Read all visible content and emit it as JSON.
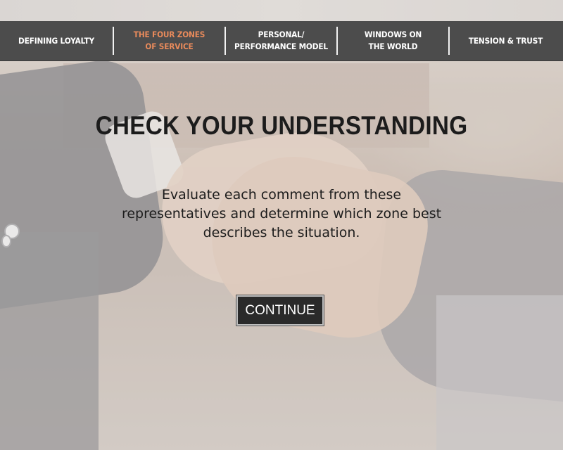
{
  "nav": {
    "items": [
      {
        "label": "DEFINING LOYALTY",
        "active": false
      },
      {
        "label": "THE FOUR ZONES\nOF SERVICE",
        "active": true
      },
      {
        "label": "PERSONAL/\nPERFORMANCE MODEL",
        "active": false
      },
      {
        "label": "WINDOWS ON\nTHE WORLD",
        "active": false
      },
      {
        "label": "TENSION & TRUST",
        "active": false
      }
    ],
    "active_color": "#e88a5b",
    "bar_color": "#4c4c4c"
  },
  "main": {
    "title": "CHECK YOUR UNDERSTANDING",
    "body_lines": [
      "Evaluate each comment from these",
      "representatives and determine which zone best",
      "describes the situation."
    ],
    "continue_label": "CONTINUE"
  }
}
